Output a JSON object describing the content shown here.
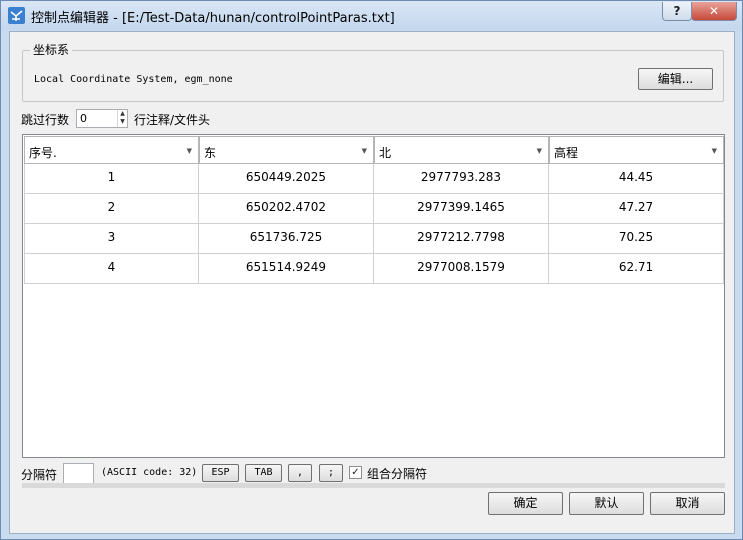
{
  "window": {
    "title": "控制点编辑器 - [E:/Test-Data/hunan/controlPointParas.txt]",
    "help_label": "?",
    "close_label": "✕"
  },
  "coord_group": {
    "legend": "坐标系",
    "value": "Local Coordinate System, egm_none",
    "edit_label": "编辑..."
  },
  "skip": {
    "label": "跳过行数",
    "value": "0",
    "suffix": "行注释/文件头"
  },
  "table": {
    "columns": [
      "序号.",
      "东",
      "北",
      "高程"
    ],
    "rows": [
      [
        "1",
        "650449.2025",
        "2977793.283",
        "44.45"
      ],
      [
        "2",
        "650202.4702",
        "2977399.1465",
        "47.27"
      ],
      [
        "3",
        "651736.725",
        "2977212.7798",
        "70.25"
      ],
      [
        "4",
        "651514.9249",
        "2977008.1579",
        "62.71"
      ]
    ]
  },
  "separator": {
    "label": "分隔符",
    "ascii_text": "(ASCII code: 32)",
    "buttons": [
      "ESP",
      "TAB",
      ",",
      ";"
    ],
    "combine_checked": true,
    "combine_label": "组合分隔符"
  },
  "footer": {
    "ok_label": "确定",
    "default_label": "默认",
    "cancel_label": "取消"
  },
  "colors": {
    "titlebar": "#c4d7ee",
    "close_button": "#c7493a"
  }
}
